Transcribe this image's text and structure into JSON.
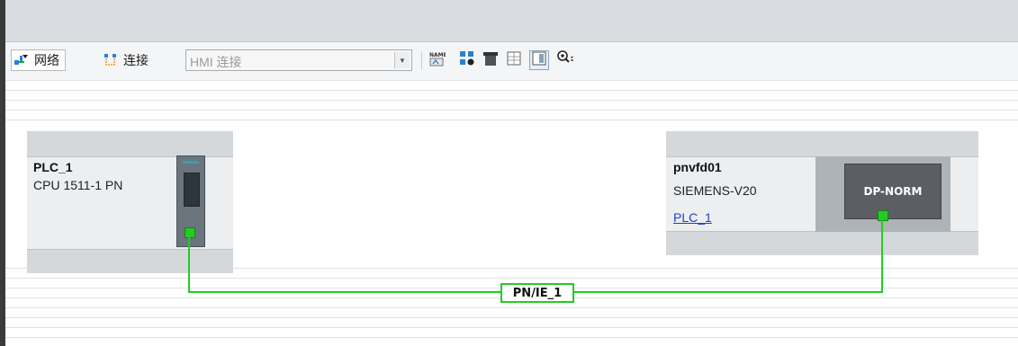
{
  "toolbar": {
    "network_label": "网络",
    "connections_label": "连接",
    "connection_type": "HMI 连接"
  },
  "devices": [
    {
      "name": "PLC_1",
      "type": "CPU 1511-1 PN"
    },
    {
      "name": "pnvfd01",
      "type": "SIEMENS-V20",
      "assigned_controller": "PLC_1",
      "module_label": "DP-NORM"
    }
  ],
  "network": {
    "subnet_name": "PN/IE_1"
  },
  "colors": {
    "network_line": "#22cc22",
    "device_bg": "#d5d8db"
  }
}
